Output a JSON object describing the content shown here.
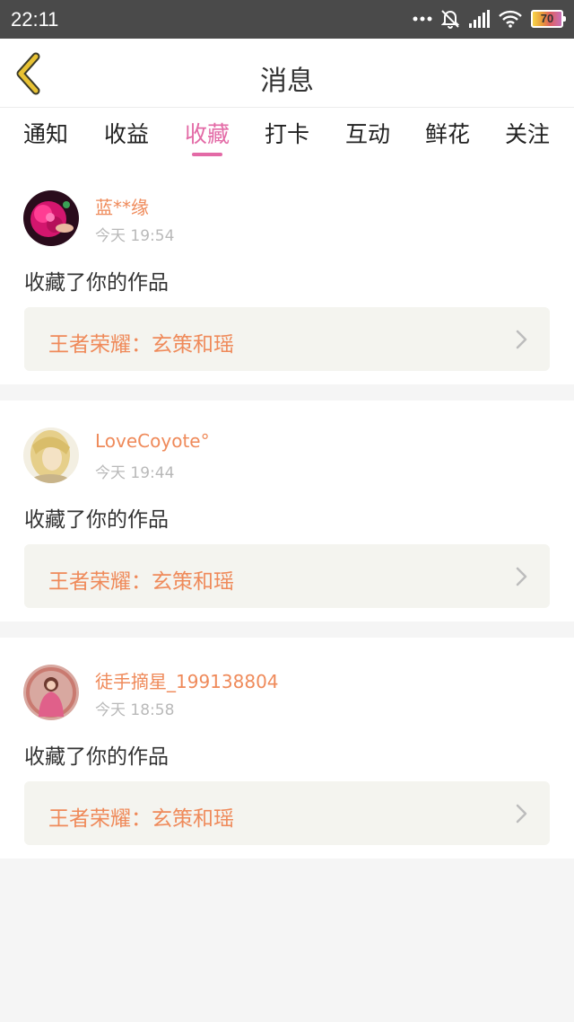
{
  "status_bar": {
    "time": "22:11",
    "battery_level": "70",
    "icons": [
      "more-dots-icon",
      "notification-muted-icon",
      "signal-icon",
      "wifi-icon",
      "battery-icon"
    ]
  },
  "header": {
    "title": "消息",
    "back_icon": "chevron-left-icon",
    "back_color": "#e8c233"
  },
  "tabs": [
    {
      "label": "通知",
      "active": false
    },
    {
      "label": "收益",
      "active": false
    },
    {
      "label": "收藏",
      "active": true
    },
    {
      "label": "打卡",
      "active": false
    },
    {
      "label": "互动",
      "active": false
    },
    {
      "label": "鲜花",
      "active": false
    },
    {
      "label": "关注",
      "active": false
    }
  ],
  "colors": {
    "accent_pink": "#e36aa6",
    "name_orange": "#ef8a5a",
    "status_bar": "#4a4a4a",
    "page_bg": "#f5f5f5",
    "link_bg": "#f4f4ef"
  },
  "messages": [
    {
      "username": "蓝**缘",
      "time": "今天 19:54",
      "action": "收藏了你的作品",
      "work_title": "王者荣耀：玄策和瑶",
      "avatar": "avatar-pink-flower"
    },
    {
      "username": "LoveCoyote°",
      "time": "今天 19:44",
      "action": "收藏了你的作品",
      "work_title": "王者荣耀：玄策和瑶",
      "avatar": "avatar-blond-anime-character"
    },
    {
      "username": "徒手摘星_199138804",
      "time": "今天 18:58",
      "action": "收藏了你的作品",
      "work_title": "王者荣耀：玄策和瑶",
      "avatar": "avatar-pink-figure"
    }
  ]
}
